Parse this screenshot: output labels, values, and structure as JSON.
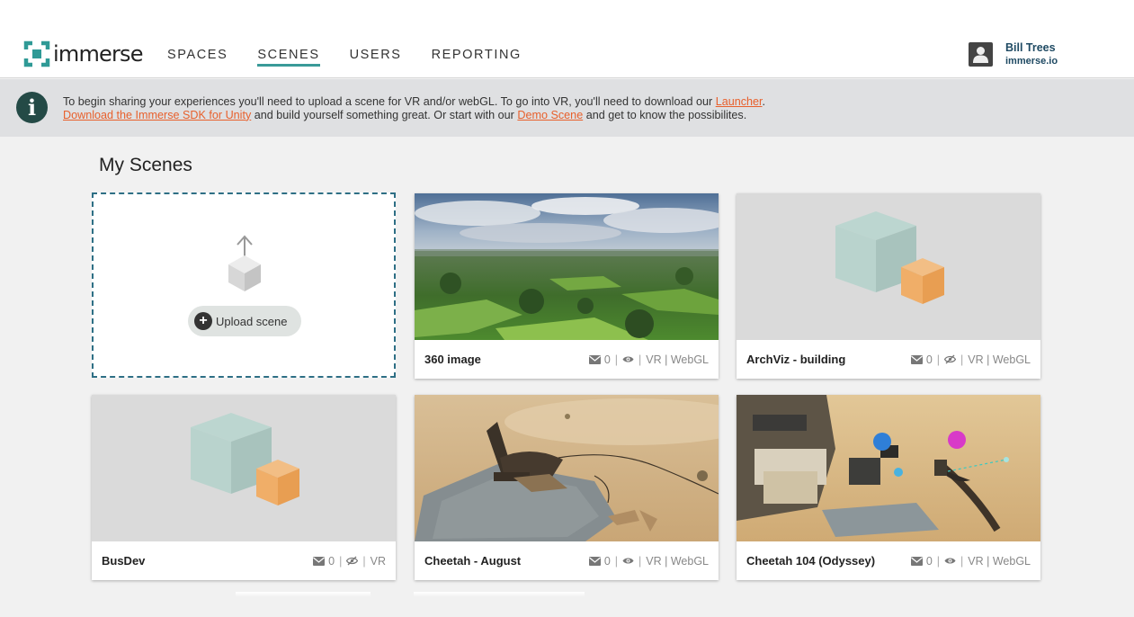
{
  "app": {
    "logo_text": "immerse",
    "brand_color": "#2f9a96",
    "accent_color": "#e8602c"
  },
  "nav": {
    "items": [
      {
        "label": "SPACES",
        "active": false
      },
      {
        "label": "SCENES",
        "active": true
      },
      {
        "label": "USERS",
        "active": false
      },
      {
        "label": "REPORTING",
        "active": false
      }
    ]
  },
  "user": {
    "name": "Bill Trees",
    "org": "immerse.io",
    "icon": "user-icon"
  },
  "banner": {
    "icon": "info-icon",
    "text_1": "To begin sharing your experiences you'll need to upload a scene for VR and/or webGL. To go into VR, you'll need to download our ",
    "link_launcher": "Launcher",
    "text_2": ".",
    "link_sdk": "Download the Immerse SDK for Unity",
    "text_3": " and build yourself something great. Or start with our ",
    "link_demo": "Demo Scene",
    "text_4": " and get to know the possibilites."
  },
  "main": {
    "title": "My Scenes",
    "upload": {
      "label": "Upload scene",
      "icon": "upload-box-icon"
    },
    "scenes": [
      {
        "name": "360 image",
        "count": "0",
        "visibility": "visible",
        "platforms": "VR | WebGL",
        "thumb": "landscape"
      },
      {
        "name": "ArchViz - building",
        "count": "0",
        "visibility": "hidden",
        "platforms": "VR | WebGL",
        "thumb": "placeholder"
      },
      {
        "name": "BusDev",
        "count": "0",
        "visibility": "hidden",
        "platforms": "VR",
        "thumb": "placeholder"
      },
      {
        "name": "Cheetah - August",
        "count": "0",
        "visibility": "visible",
        "platforms": "VR | WebGL",
        "thumb": "desert"
      },
      {
        "name": "Cheetah 104 (Odyssey)",
        "count": "0",
        "visibility": "visible",
        "platforms": "VR | WebGL",
        "thumb": "desert-equipment"
      }
    ]
  }
}
